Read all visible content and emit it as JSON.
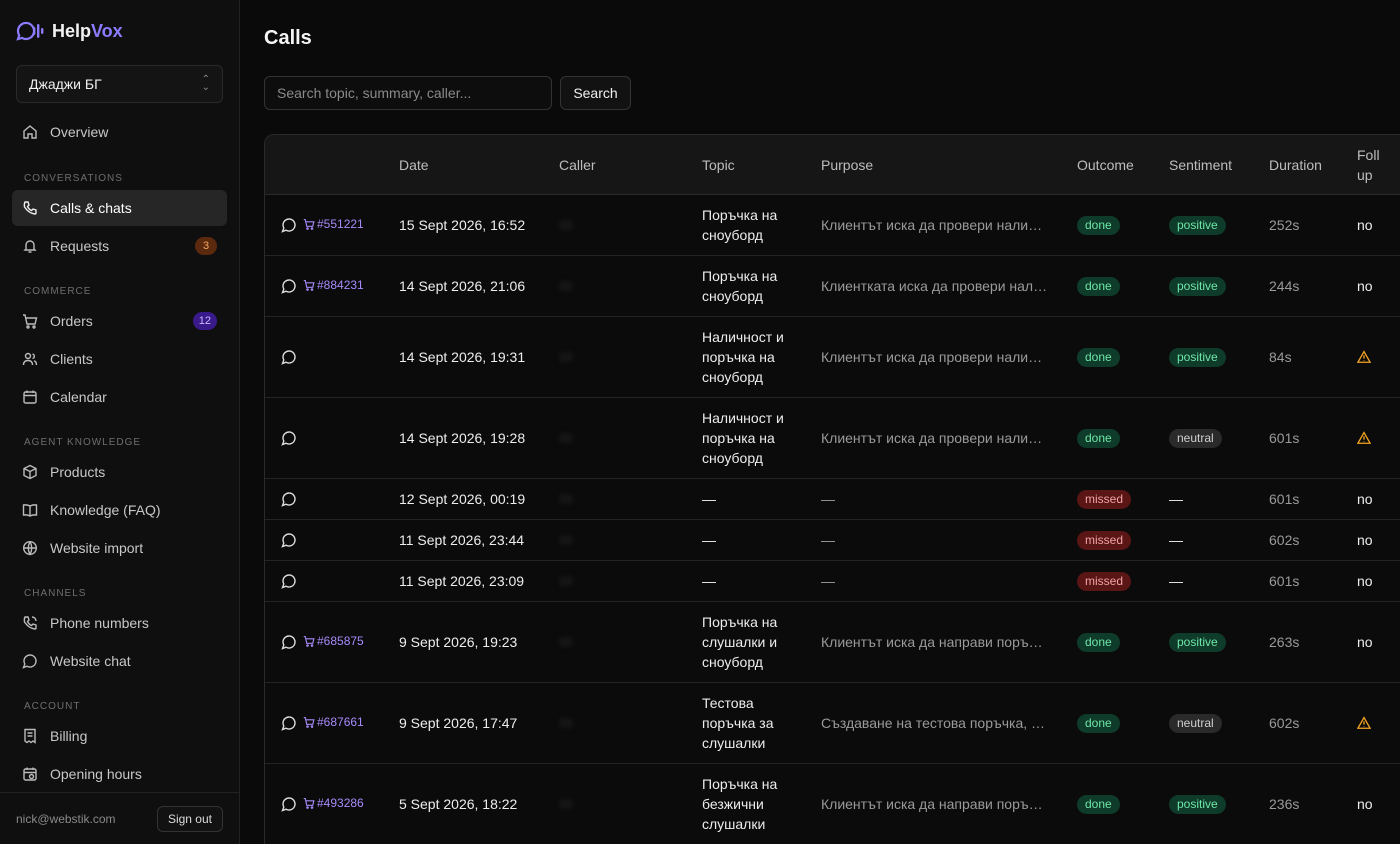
{
  "brand": {
    "help": "Help",
    "vox": "Vox",
    "accent": "#8b7bff"
  },
  "org": {
    "selected": "Джаджи БГ"
  },
  "nav": {
    "overview": "Overview",
    "sections": {
      "conversations": "CONVERSATIONS",
      "commerce": "COMMERCE",
      "knowledge": "AGENT KNOWLEDGE",
      "channels": "CHANNELS",
      "account": "ACCOUNT"
    },
    "calls_chats": "Calls & chats",
    "requests": "Requests",
    "requests_badge": "3",
    "orders": "Orders",
    "orders_badge": "12",
    "clients": "Clients",
    "calendar": "Calendar",
    "products": "Products",
    "knowledge_faq": "Knowledge (FAQ)",
    "website_import": "Website import",
    "phone_numbers": "Phone numbers",
    "website_chat": "Website chat",
    "billing": "Billing",
    "opening_hours": "Opening hours"
  },
  "footer": {
    "email": "nick@webstik.com",
    "sign_out": "Sign out"
  },
  "page": {
    "title": "Calls"
  },
  "search": {
    "placeholder": "Search topic, summary, caller...",
    "button": "Search"
  },
  "table": {
    "headers": {
      "date": "Date",
      "caller": "Caller",
      "topic": "Topic",
      "purpose": "Purpose",
      "outcome": "Outcome",
      "sentiment": "Sentiment",
      "duration": "Duration",
      "follow_up": "Follow up"
    },
    "rows": [
      {
        "order": "#551221",
        "date": "15 Sept 2026, 16:52",
        "topic": "Поръчка на сноуборд",
        "purpose": "Клиентът иска да провери наличност на сноуборд",
        "outcome": "done",
        "sentiment": "positive",
        "duration": "252s",
        "follow": "no"
      },
      {
        "order": "#884231",
        "date": "14 Sept 2026, 21:06",
        "topic": "Поръчка на сноуборд",
        "purpose": "Клиентката иска да провери наличност на сноуборд",
        "outcome": "done",
        "sentiment": "positive",
        "duration": "244s",
        "follow": "no"
      },
      {
        "order": "",
        "date": "14 Sept 2026, 19:31",
        "topic": "Наличност и поръчка на сноуборд",
        "purpose": "Клиентът иска да провери наличност на сноуборд",
        "outcome": "done",
        "sentiment": "positive",
        "duration": "84s",
        "follow": "warn"
      },
      {
        "order": "",
        "date": "14 Sept 2026, 19:28",
        "topic": "Наличност и поръчка на сноуборд",
        "purpose": "Клиентът иска да провери наличност на сноуборд",
        "outcome": "done",
        "sentiment": "neutral",
        "duration": "601s",
        "follow": "warn"
      },
      {
        "order": "",
        "date": "12 Sept 2026, 00:19",
        "topic": "—",
        "purpose": "—",
        "outcome": "missed",
        "sentiment": "—",
        "duration": "601s",
        "follow": "no"
      },
      {
        "order": "",
        "date": "11 Sept 2026, 23:44",
        "topic": "—",
        "purpose": "—",
        "outcome": "missed",
        "sentiment": "—",
        "duration": "602s",
        "follow": "no"
      },
      {
        "order": "",
        "date": "11 Sept 2026, 23:09",
        "topic": "—",
        "purpose": "—",
        "outcome": "missed",
        "sentiment": "—",
        "duration": "601s",
        "follow": "no"
      },
      {
        "order": "#685875",
        "date": "9 Sept 2026, 19:23",
        "topic": "Поръчка на слушалки и сноуборд",
        "purpose": "Клиентът иска да направи поръчка на слушалки",
        "outcome": "done",
        "sentiment": "positive",
        "duration": "263s",
        "follow": "no"
      },
      {
        "order": "#687661",
        "date": "9 Sept 2026, 17:47",
        "topic": "Тестова поръчка за слушалки",
        "purpose": "Създаване на тестова поръчка, слушалки",
        "outcome": "done",
        "sentiment": "neutral",
        "duration": "602s",
        "follow": "warn"
      },
      {
        "order": "#493286",
        "date": "5 Sept 2026, 18:22",
        "topic": "Поръчка на безжични слушалки",
        "purpose": "Клиентът иска да направи поръчка на слушалки",
        "outcome": "done",
        "sentiment": "positive",
        "duration": "236s",
        "follow": "no"
      }
    ]
  }
}
